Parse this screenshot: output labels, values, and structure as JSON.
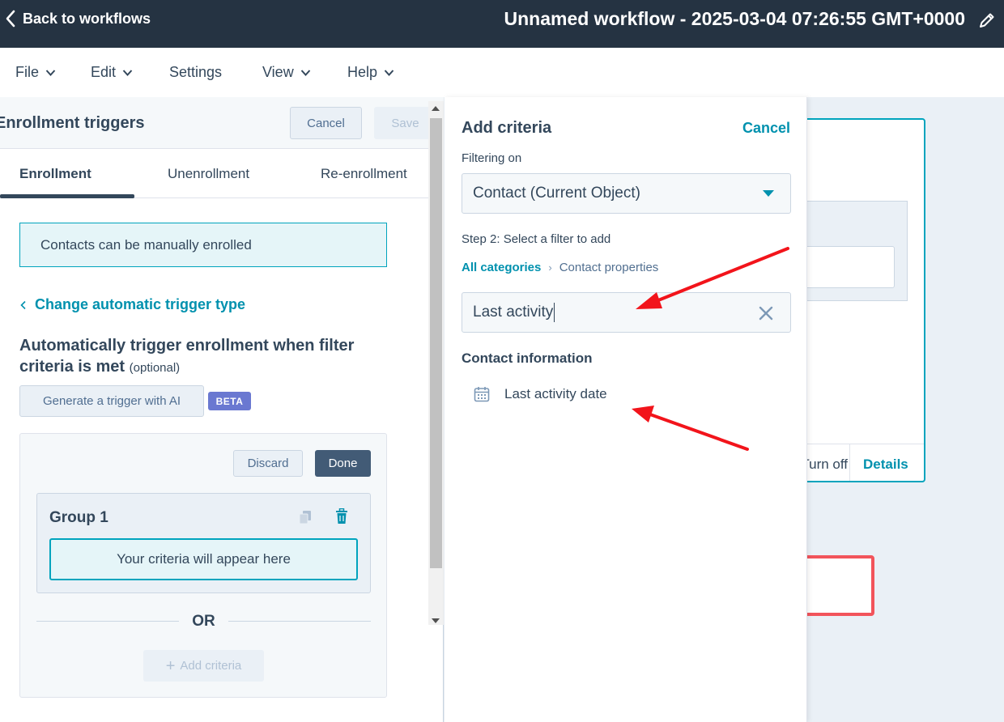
{
  "topbar": {
    "back_label": "Back to workflows",
    "workflow_title": "Unnamed workflow - 2025-03-04 07:26:55 GMT+0000"
  },
  "menu": {
    "items": [
      {
        "label": "File",
        "dropdown": true
      },
      {
        "label": "Edit",
        "dropdown": true
      },
      {
        "label": "Settings",
        "dropdown": false
      },
      {
        "label": "View",
        "dropdown": true
      },
      {
        "label": "Help",
        "dropdown": true
      }
    ]
  },
  "left_panel": {
    "title": "Enrollment triggers",
    "cancel_label": "Cancel",
    "save_label": "Save",
    "tabs": [
      "Enrollment",
      "Unenrollment",
      "Re-enrollment"
    ],
    "active_tab": "Enrollment",
    "manual_text": "Contacts can be manually enrolled",
    "change_link": "Change automatic trigger type",
    "auto_title": "Automatically trigger enrollment when filter criteria is met",
    "optional_label": "(optional)",
    "generate_label": "Generate a trigger with AI",
    "beta_label": "BETA",
    "discard_label": "Discard",
    "done_label": "Done",
    "group_title": "Group 1",
    "criteria_placeholder": "Your criteria will appear here",
    "or_label": "OR",
    "add_criteria_label": "Add criteria"
  },
  "criteria_panel": {
    "title": "Add criteria",
    "cancel_label": "Cancel",
    "filtering_label": "Filtering on",
    "object_value": "Contact (Current Object)",
    "step_label": "Step 2: Select a filter to add",
    "breadcrumb": {
      "link": "All categories",
      "current": "Contact properties"
    },
    "search_value": "Last activity",
    "section_heading": "Contact information",
    "results": [
      "Last activity date"
    ]
  },
  "canvas": {
    "card_off_text": "Turn off",
    "card_details_label": "Details"
  },
  "colors": {
    "topbar": "#253342",
    "accent": "#0091ae",
    "teal_border": "#00a4bd",
    "annotation_red": "#f2141b"
  }
}
